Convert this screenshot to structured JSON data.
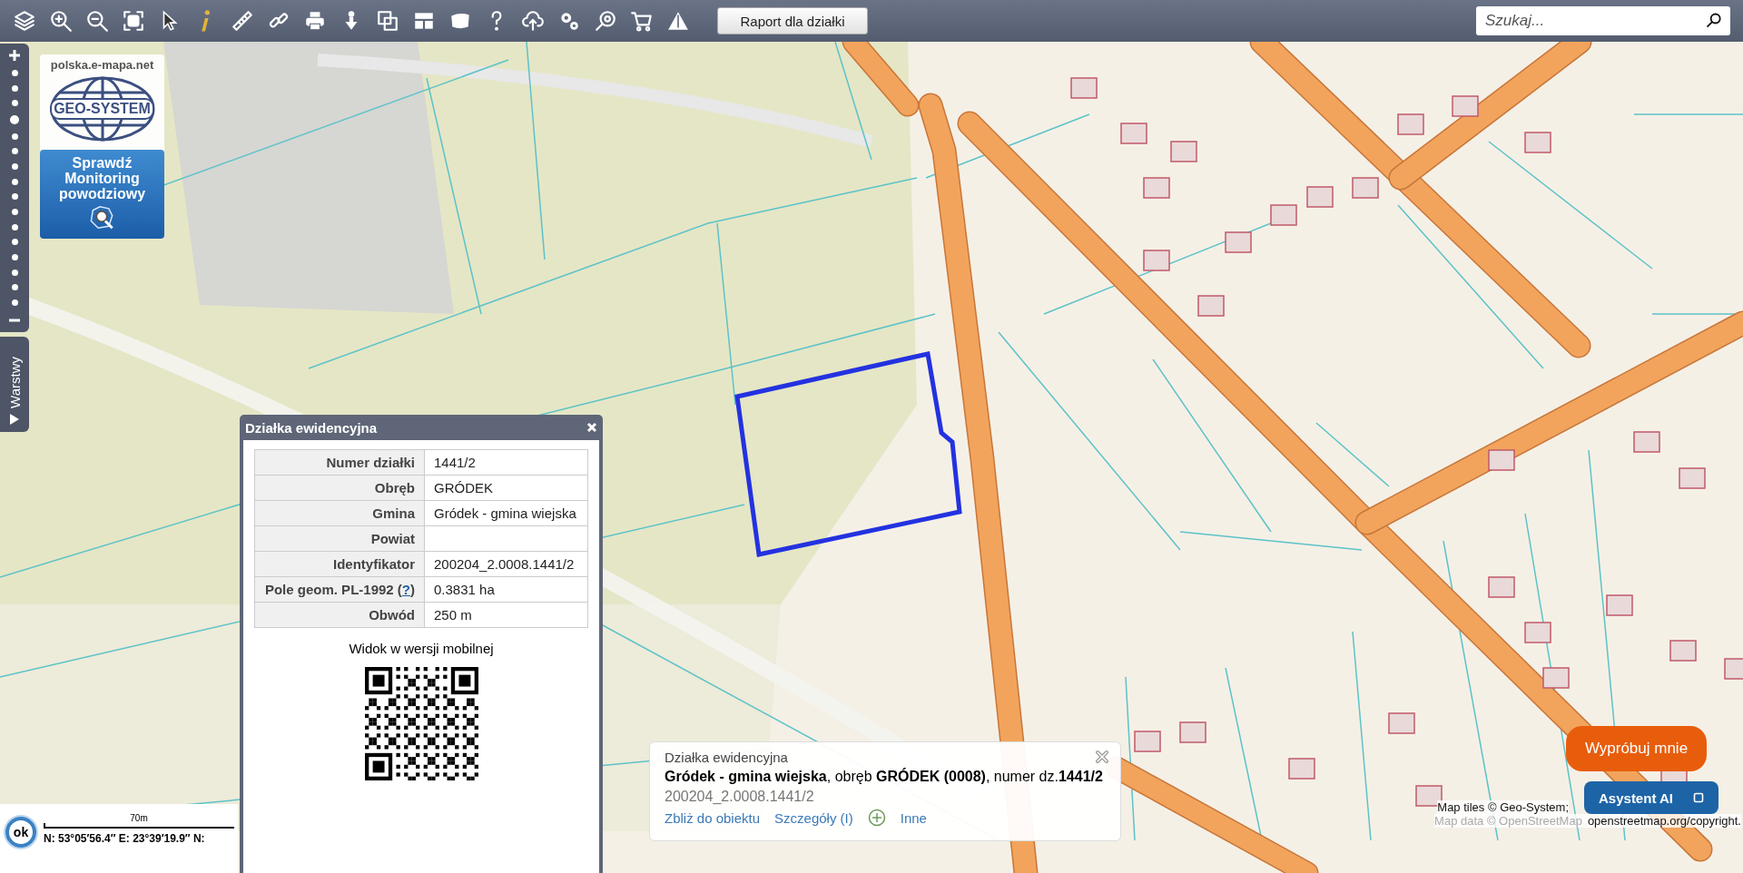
{
  "toolbar": {
    "report_button": "Raport dla działki",
    "search": {
      "placeholder": "Szukaj..."
    }
  },
  "zoom": {
    "level": 0.8
  },
  "layers_tab": "Warstwy",
  "promo": {
    "site": "polska.e-mapa.net",
    "logo": "GEO-SYSTEM",
    "button": "Sprawdź Monitoring powodziowy"
  },
  "popup": {
    "title": "Działka ewidencyjna",
    "rows": [
      {
        "label": "Numer działki",
        "value": "1441/2"
      },
      {
        "label": "Obręb",
        "value": "GRÓDEK"
      },
      {
        "label": "Gmina",
        "value": "Gródek - gmina wiejska"
      },
      {
        "label": "Powiat"
      },
      {
        "label": "Identyfikator",
        "value": "200204_2.0008.1441/2"
      },
      {
        "label": "Pole geom. PL-1992 (",
        "help": "?",
        "label_after": ")",
        "value": "0.3831 ha"
      },
      {
        "label": "Obwód",
        "value": "250 m"
      }
    ],
    "mobile_caption": "Widok w wersji mobilnej"
  },
  "status": {
    "ok": "ok",
    "scale": "70m",
    "coords": "N: 53°05′56.4″ E: 23°39′19.9″ N:"
  },
  "info_card": {
    "title": "Działka ewidencyjna",
    "summary": "**Gródek - gmina wiejska**, obręb **GRÓDEK (0008)**, numer dz.**1441/2**",
    "id": "200204_2.0008.1441/2",
    "links": [
      {
        "kind": "link",
        "label": "Zbliż do obiektu"
      },
      {
        "kind": "link",
        "label": "Szczegóły (I)"
      },
      {
        "kind": "add"
      },
      {
        "kind": "link",
        "label": "Inne"
      }
    ]
  },
  "assistant": {
    "bubble": "Wypróbuj mnie",
    "button": "Asystent AI"
  },
  "attribution": [
    "Map tiles © Geo-System;",
    "Map data © OpenStreetMap",
    "openstreetmap.org/copyright."
  ]
}
